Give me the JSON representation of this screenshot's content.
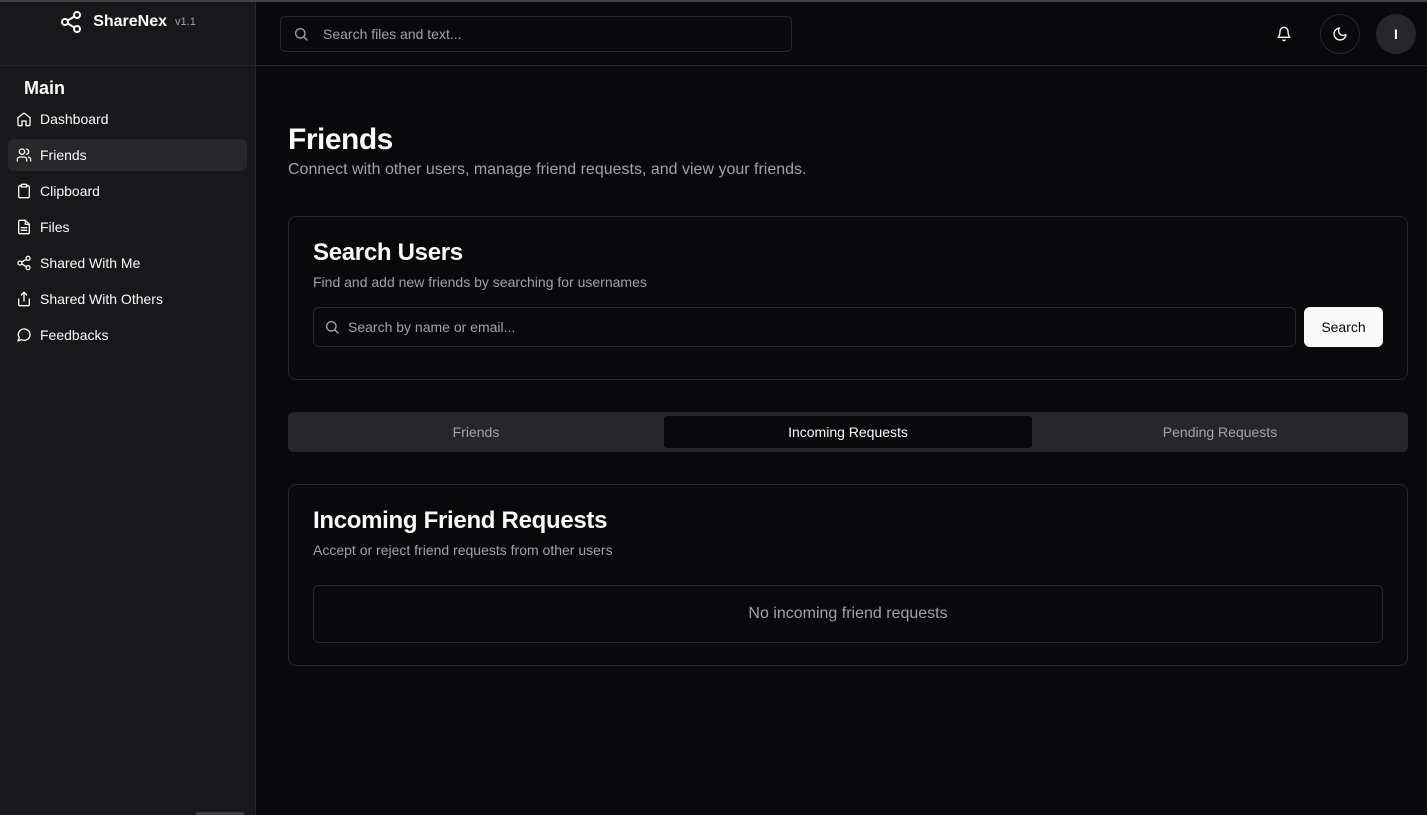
{
  "app": {
    "name": "ShareNex",
    "version": "v1.1"
  },
  "sidebar": {
    "section_title": "Main",
    "items": [
      {
        "label": "Dashboard",
        "icon": "home-icon",
        "active": false
      },
      {
        "label": "Friends",
        "icon": "users-icon",
        "active": true
      },
      {
        "label": "Clipboard",
        "icon": "clipboard-icon",
        "active": false
      },
      {
        "label": "Files",
        "icon": "file-text-icon",
        "active": false
      },
      {
        "label": "Shared With Me",
        "icon": "share-icon",
        "active": false
      },
      {
        "label": "Shared With Others",
        "icon": "upload-share-icon",
        "active": false
      },
      {
        "label": "Feedbacks",
        "icon": "message-circle-icon",
        "active": false
      }
    ]
  },
  "header": {
    "search_placeholder": "Search files and text...",
    "avatar_initial": "I"
  },
  "page": {
    "title": "Friends",
    "subtitle": "Connect with other users, manage friend requests, and view your friends."
  },
  "search_card": {
    "title": "Search Users",
    "subtitle": "Find and add new friends by searching for usernames",
    "input_placeholder": "Search by name or email...",
    "button_label": "Search"
  },
  "tabs": [
    {
      "label": "Friends",
      "active": false
    },
    {
      "label": "Incoming Requests",
      "active": true
    },
    {
      "label": "Pending Requests",
      "active": false
    }
  ],
  "requests_card": {
    "title": "Incoming Friend Requests",
    "subtitle": "Accept or reject friend requests from other users",
    "empty_message": "No incoming friend requests"
  },
  "colors": {
    "background": "#09090b",
    "sidebar": "#18181b",
    "border": "#27272a",
    "muted_text": "#a1a1aa",
    "primary": "#fafafa"
  }
}
